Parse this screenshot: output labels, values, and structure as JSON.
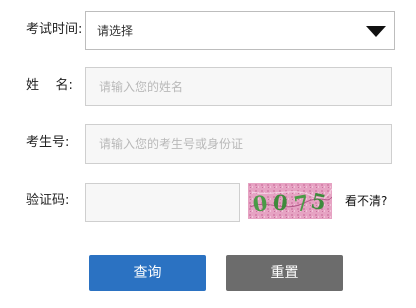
{
  "form": {
    "exam_time": {
      "label": "考试时间:",
      "selected": "请选择"
    },
    "name": {
      "label": "姓    名:",
      "placeholder": "请输入您的姓名",
      "value": ""
    },
    "exam_number": {
      "label": "考生号:",
      "placeholder": "请输入您的考生号或身份证",
      "value": ""
    },
    "captcha": {
      "label": "验证码:",
      "value": "",
      "image_text": "0075",
      "refresh_label": "看不清?"
    }
  },
  "buttons": {
    "query_label": "查询",
    "reset_label": "重置"
  },
  "colors": {
    "query_button": "#2b72c2",
    "reset_button": "#6c6c6c",
    "captcha_background": "#e8a9c6",
    "captcha_text": "#4a9a46"
  },
  "icons": {
    "dropdown": "caret-down-icon"
  }
}
